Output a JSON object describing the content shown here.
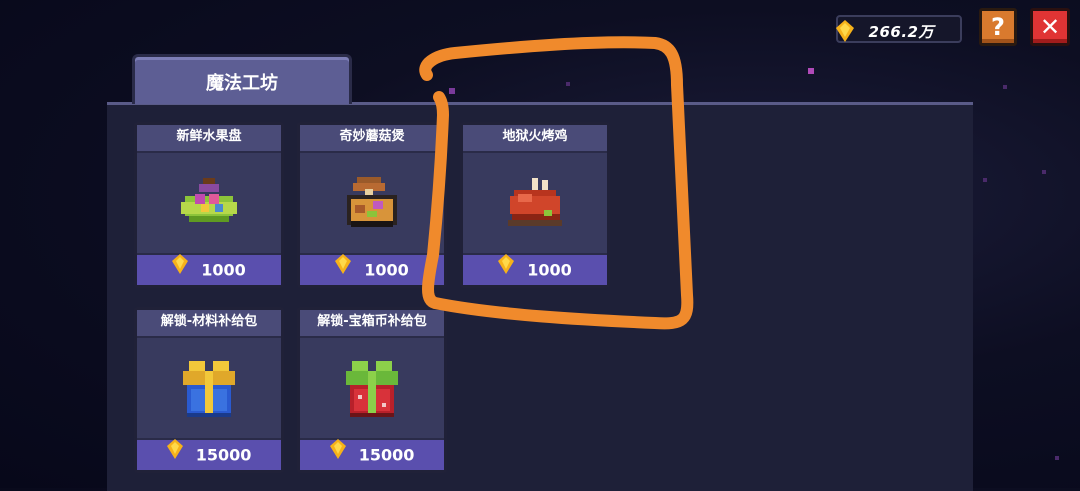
{
  "currency": {
    "amount": "266.2万",
    "icon": "gem-icon"
  },
  "buttons": {
    "help_label": "?",
    "close_label": "✕"
  },
  "tab": {
    "label": "魔法工坊"
  },
  "colors": {
    "annotation": "#f08a2c",
    "price_bar": "#5a4fae",
    "panel": "#1e2038"
  },
  "items": [
    {
      "name": "新鲜水果盘",
      "price": "1000",
      "icon": "fruit-plate-icon"
    },
    {
      "name": "奇妙蘑菇煲",
      "price": "1000",
      "icon": "mushroom-stew-icon"
    },
    {
      "name": "地狱火烤鸡",
      "price": "1000",
      "icon": "roast-chicken-icon"
    },
    {
      "name": "解锁-材料补给包",
      "price": "15000",
      "icon": "blue-gift-box-icon"
    },
    {
      "name": "解锁-宝箱币补给包",
      "price": "15000",
      "icon": "red-gift-box-icon"
    }
  ]
}
